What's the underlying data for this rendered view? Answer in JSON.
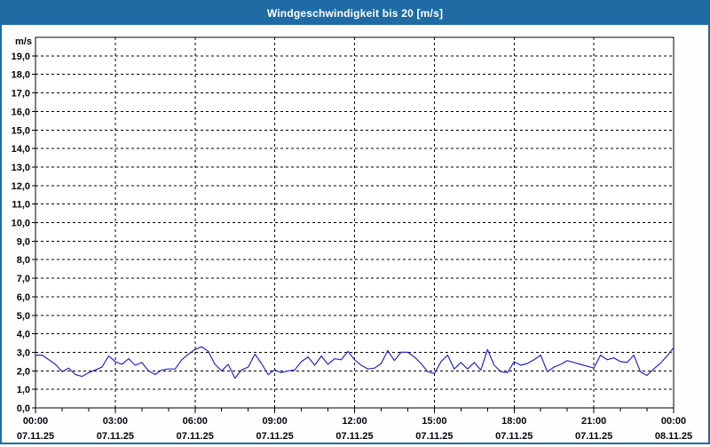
{
  "window": {
    "title": "Windgeschwindigkeit bis 20 [m/s]"
  },
  "colors": {
    "titlebar_bg": "#1e6ca3",
    "window_border": "#1e6ca3",
    "title_text": "#ffffff",
    "plot_bg": "#ffffff",
    "grid": "#000000",
    "axis": "#000000",
    "line": "#2626c8",
    "label_text": "#05050f"
  },
  "chart_data": {
    "type": "line",
    "title": "Windgeschwindigkeit bis 20 [m/s]",
    "ylabel_unit": "m/s",
    "ylim": [
      0,
      20
    ],
    "y_tick_step": 1.0,
    "y_tick_labels": [
      "0,0",
      "1,0",
      "2,0",
      "3,0",
      "4,0",
      "5,0",
      "6,0",
      "7,0",
      "8,0",
      "9,0",
      "10,0",
      "11,0",
      "12,0",
      "13,0",
      "14,0",
      "15,0",
      "16,0",
      "17,0",
      "18,0",
      "19,0"
    ],
    "x_hours_range": [
      0,
      24
    ],
    "x_major_step_hours": 3,
    "x_minor_step_hours": 1,
    "x_major_ticks": [
      {
        "time": "00:00",
        "date": "07.11.25"
      },
      {
        "time": "03:00",
        "date": "07.11.25"
      },
      {
        "time": "06:00",
        "date": "07.11.25"
      },
      {
        "time": "09:00",
        "date": "07.11.25"
      },
      {
        "time": "12:00",
        "date": "07.11.25"
      },
      {
        "time": "15:00",
        "date": "07.11.25"
      },
      {
        "time": "18:00",
        "date": "07.11.25"
      },
      {
        "time": "21:00",
        "date": "07.11.25"
      },
      {
        "time": "00:00",
        "date": "08.11.25"
      }
    ],
    "grid_on": true,
    "legend": "none",
    "sample_interval_hours": 0.25,
    "series": [
      {
        "name": "Windgeschwindigkeit",
        "values": [
          2.85,
          2.85,
          2.6,
          2.35,
          1.95,
          2.15,
          1.8,
          1.7,
          1.9,
          2.05,
          2.2,
          2.8,
          2.5,
          2.35,
          2.65,
          2.3,
          2.45,
          2.0,
          1.8,
          2.05,
          2.1,
          2.1,
          2.6,
          2.9,
          3.15,
          3.3,
          3.05,
          2.35,
          2.0,
          2.35,
          1.6,
          2.05,
          2.2,
          2.9,
          2.4,
          1.8,
          2.05,
          1.9,
          2.0,
          2.05,
          2.5,
          2.75,
          2.3,
          2.8,
          2.35,
          2.65,
          2.6,
          3.05,
          2.6,
          2.3,
          2.1,
          2.15,
          2.4,
          3.1,
          2.55,
          3.0,
          3.0,
          2.75,
          2.4,
          1.95,
          1.85,
          2.5,
          2.85,
          2.1,
          2.45,
          2.1,
          2.45,
          2.05,
          3.15,
          2.3,
          1.95,
          1.9,
          2.5,
          2.3,
          2.4,
          2.6,
          2.85,
          1.95,
          2.2,
          2.35,
          2.55,
          2.45,
          2.35,
          2.25,
          2.15,
          2.85,
          2.6,
          2.7,
          2.5,
          2.45,
          2.85,
          1.95,
          1.75,
          2.1,
          2.4,
          2.8,
          3.25
        ]
      }
    ]
  }
}
